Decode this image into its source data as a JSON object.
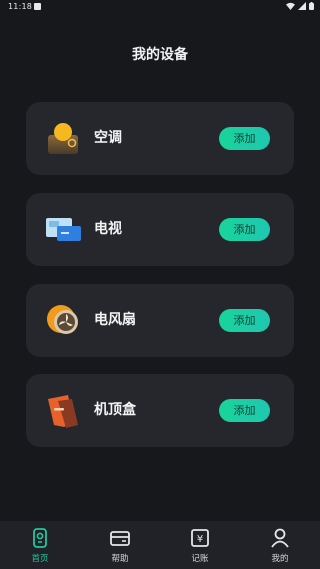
{
  "status_bar": {
    "time": "11:18"
  },
  "page": {
    "title": "我的设备"
  },
  "devices": [
    {
      "name": "空调",
      "icon": "air-conditioner-icon",
      "button": "添加"
    },
    {
      "name": "电视",
      "icon": "tv-icon",
      "button": "添加"
    },
    {
      "name": "电风扇",
      "icon": "fan-icon",
      "button": "添加"
    },
    {
      "name": "机顶盒",
      "icon": "set-top-box-icon",
      "button": "添加"
    }
  ],
  "tabs": [
    {
      "label": "首页",
      "icon": "home-remote-icon",
      "active": true
    },
    {
      "label": "帮助",
      "icon": "wallet-icon",
      "active": false
    },
    {
      "label": "记账",
      "icon": "yuan-receipt-icon",
      "active": false
    },
    {
      "label": "我的",
      "icon": "user-icon",
      "active": false
    }
  ],
  "colors": {
    "accent": "#1fcfa6",
    "background": "#17181c",
    "card": "#25272d",
    "tabbar": "#202227"
  }
}
